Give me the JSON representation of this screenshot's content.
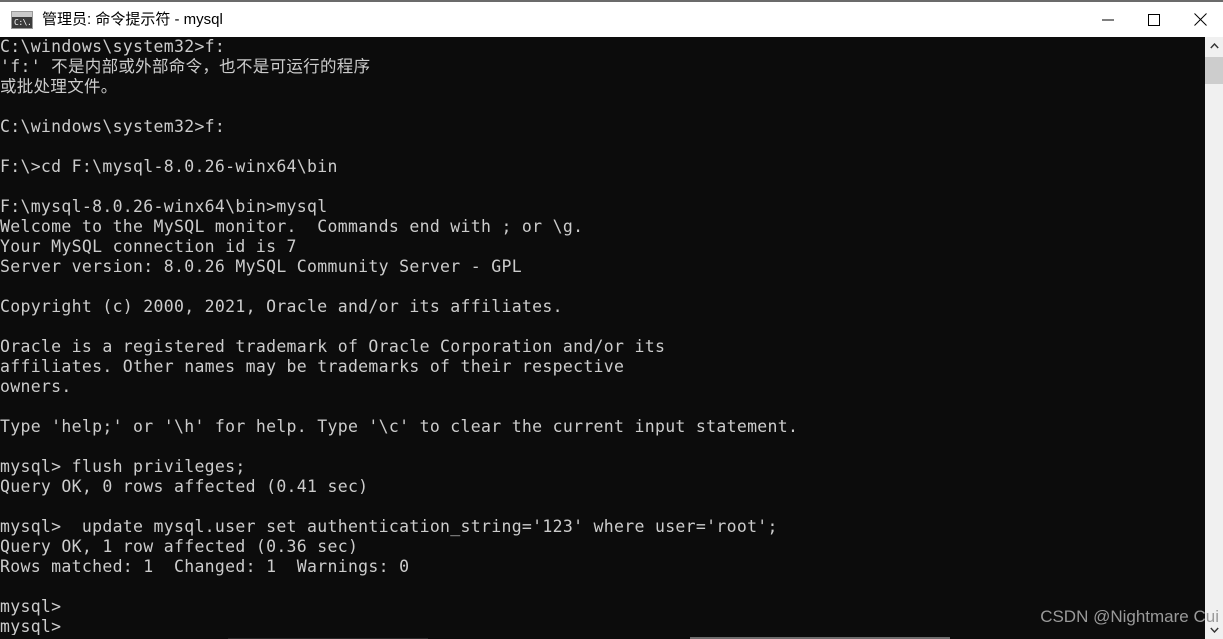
{
  "window": {
    "title": "管理员: 命令提示符 - mysql",
    "icon": "cmd-console-icon",
    "icon_glyph": "C:\\.",
    "background_color": "#0c0c0c",
    "text_color": "#cccccc",
    "titlebar_color": "#ffffff"
  },
  "titlebar_buttons": {
    "minimize": "minimize-icon",
    "maximize": "maximize-icon",
    "close": "close-icon"
  },
  "console": {
    "lines": [
      "C:\\windows\\system32>f:",
      "'f:' 不是内部或外部命令，也不是可运行的程序",
      "或批处理文件。",
      "",
      "C:\\windows\\system32>f:",
      "",
      "F:\\>cd F:\\mysql-8.0.26-winx64\\bin",
      "",
      "F:\\mysql-8.0.26-winx64\\bin>mysql",
      "Welcome to the MySQL monitor.  Commands end with ; or \\g.",
      "Your MySQL connection id is 7",
      "Server version: 8.0.26 MySQL Community Server - GPL",
      "",
      "Copyright (c) 2000, 2021, Oracle and/or its affiliates.",
      "",
      "Oracle is a registered trademark of Oracle Corporation and/or its",
      "affiliates. Other names may be trademarks of their respective",
      "owners.",
      "",
      "Type 'help;' or '\\h' for help. Type '\\c' to clear the current input statement.",
      "",
      "mysql> flush privileges;",
      "Query OK, 0 rows affected (0.41 sec)",
      "",
      "mysql>  update mysql.user set authentication_string='123' where user='root';",
      "Query OK, 1 row affected (0.36 sec)",
      "Rows matched: 1  Changed: 1  Warnings: 0",
      "",
      "mysql>",
      "mysql>"
    ]
  },
  "scrollbar": {
    "up_arrow": "chevron-up-icon",
    "down_arrow": "chevron-down-icon",
    "thumb": "scrollbar-thumb"
  },
  "watermark": {
    "text": "CSDN @Nightmare Cui",
    "color": "#9a9a9a"
  }
}
